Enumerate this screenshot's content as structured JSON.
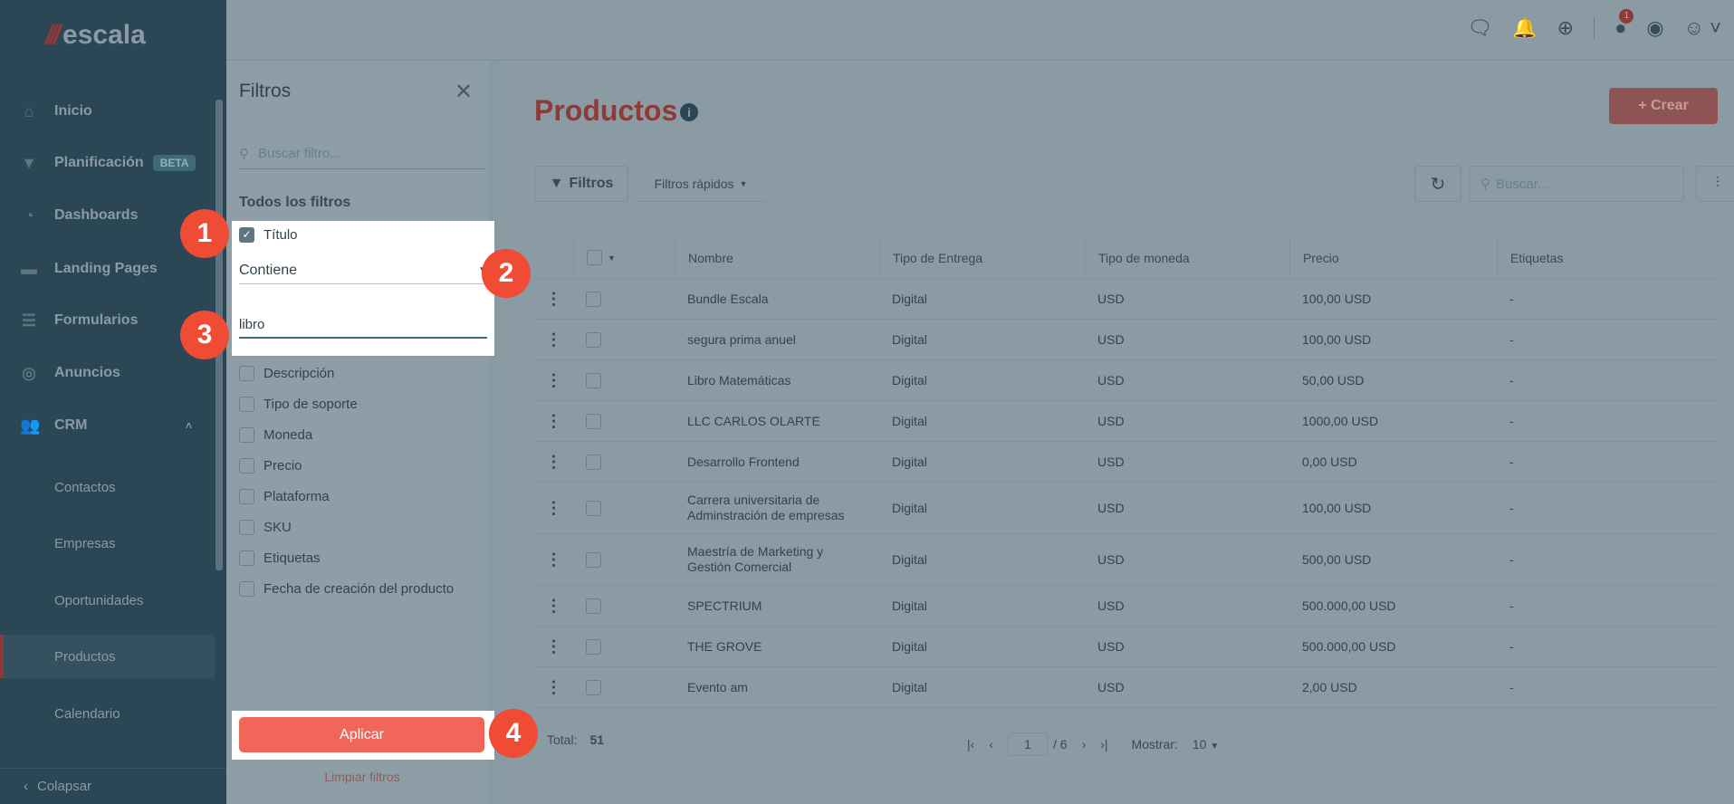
{
  "app": {
    "logo": "escala"
  },
  "sidebar": {
    "items": [
      {
        "label": "Inicio",
        "icon": "home-icon"
      },
      {
        "label": "Planificación",
        "badge": "BETA",
        "icon": "funnel-icon"
      },
      {
        "label": "Dashboards",
        "icon": "pie-chart-icon"
      },
      {
        "label": "Landing Pages",
        "icon": "page-icon"
      },
      {
        "label": "Formularios",
        "icon": "form-icon"
      },
      {
        "label": "Anuncios",
        "icon": "target-icon"
      },
      {
        "label": "CRM",
        "icon": "users-icon"
      }
    ],
    "crm_items": [
      "Contactos",
      "Empresas",
      "Oportunidades",
      "Productos",
      "Calendario"
    ],
    "collapse": "Colapsar"
  },
  "header": {
    "notification_count": "1"
  },
  "filters": {
    "title": "Filtros",
    "search_placeholder": "Buscar filtro...",
    "all_label": "Todos los filtros",
    "titulo": {
      "label": "Título",
      "operator": "Contiene",
      "value": "libro"
    },
    "options": [
      "Descripción",
      "Tipo de soporte",
      "Moneda",
      "Precio",
      "Plataforma",
      "SKU",
      "Etiquetas",
      "Fecha de creación del producto"
    ],
    "apply": "Aplicar",
    "clear": "Limpiar filtros"
  },
  "steps": [
    "1",
    "2",
    "3",
    "4"
  ],
  "main": {
    "title": "Productos",
    "create": "+ Crear",
    "filters_btn": "Filtros",
    "quick_filters": "Filtros rápidos",
    "search_placeholder": "Buscar...",
    "columns": [
      "Nombre",
      "Tipo de Entrega",
      "Tipo de moneda",
      "Precio",
      "Etiquetas"
    ],
    "rows": [
      [
        "Bundle Escala",
        "Digital",
        "USD",
        "100,00 USD",
        "-"
      ],
      [
        "segura prima anuel",
        "Digital",
        "USD",
        "100,00 USD",
        "-"
      ],
      [
        "Libro Matemáticas",
        "Digital",
        "USD",
        "50,00 USD",
        "-"
      ],
      [
        "LLC CARLOS OLARTE",
        "Digital",
        "USD",
        "1000,00 USD",
        "-"
      ],
      [
        "Desarrollo Frontend",
        "Digital",
        "USD",
        "0,00 USD",
        "-"
      ],
      [
        "Carrera universitaria de Adminstración de empresas",
        "Digital",
        "USD",
        "100,00 USD",
        "-"
      ],
      [
        "Maestría de Marketing y Gestión Comercial",
        "Digital",
        "USD",
        "500,00 USD",
        "-"
      ],
      [
        "SPECTRIUM",
        "Digital",
        "USD",
        "500.000,00 USD",
        "-"
      ],
      [
        "THE GROVE",
        "Digital",
        "USD",
        "500.000,00 USD",
        "-"
      ],
      [
        "Evento am",
        "Digital",
        "USD",
        "2,00 USD",
        "-"
      ]
    ],
    "total_label": "Total:",
    "total": "51",
    "page": "1",
    "pages": "/ 6",
    "show_label": "Mostrar:",
    "page_size": "10"
  }
}
